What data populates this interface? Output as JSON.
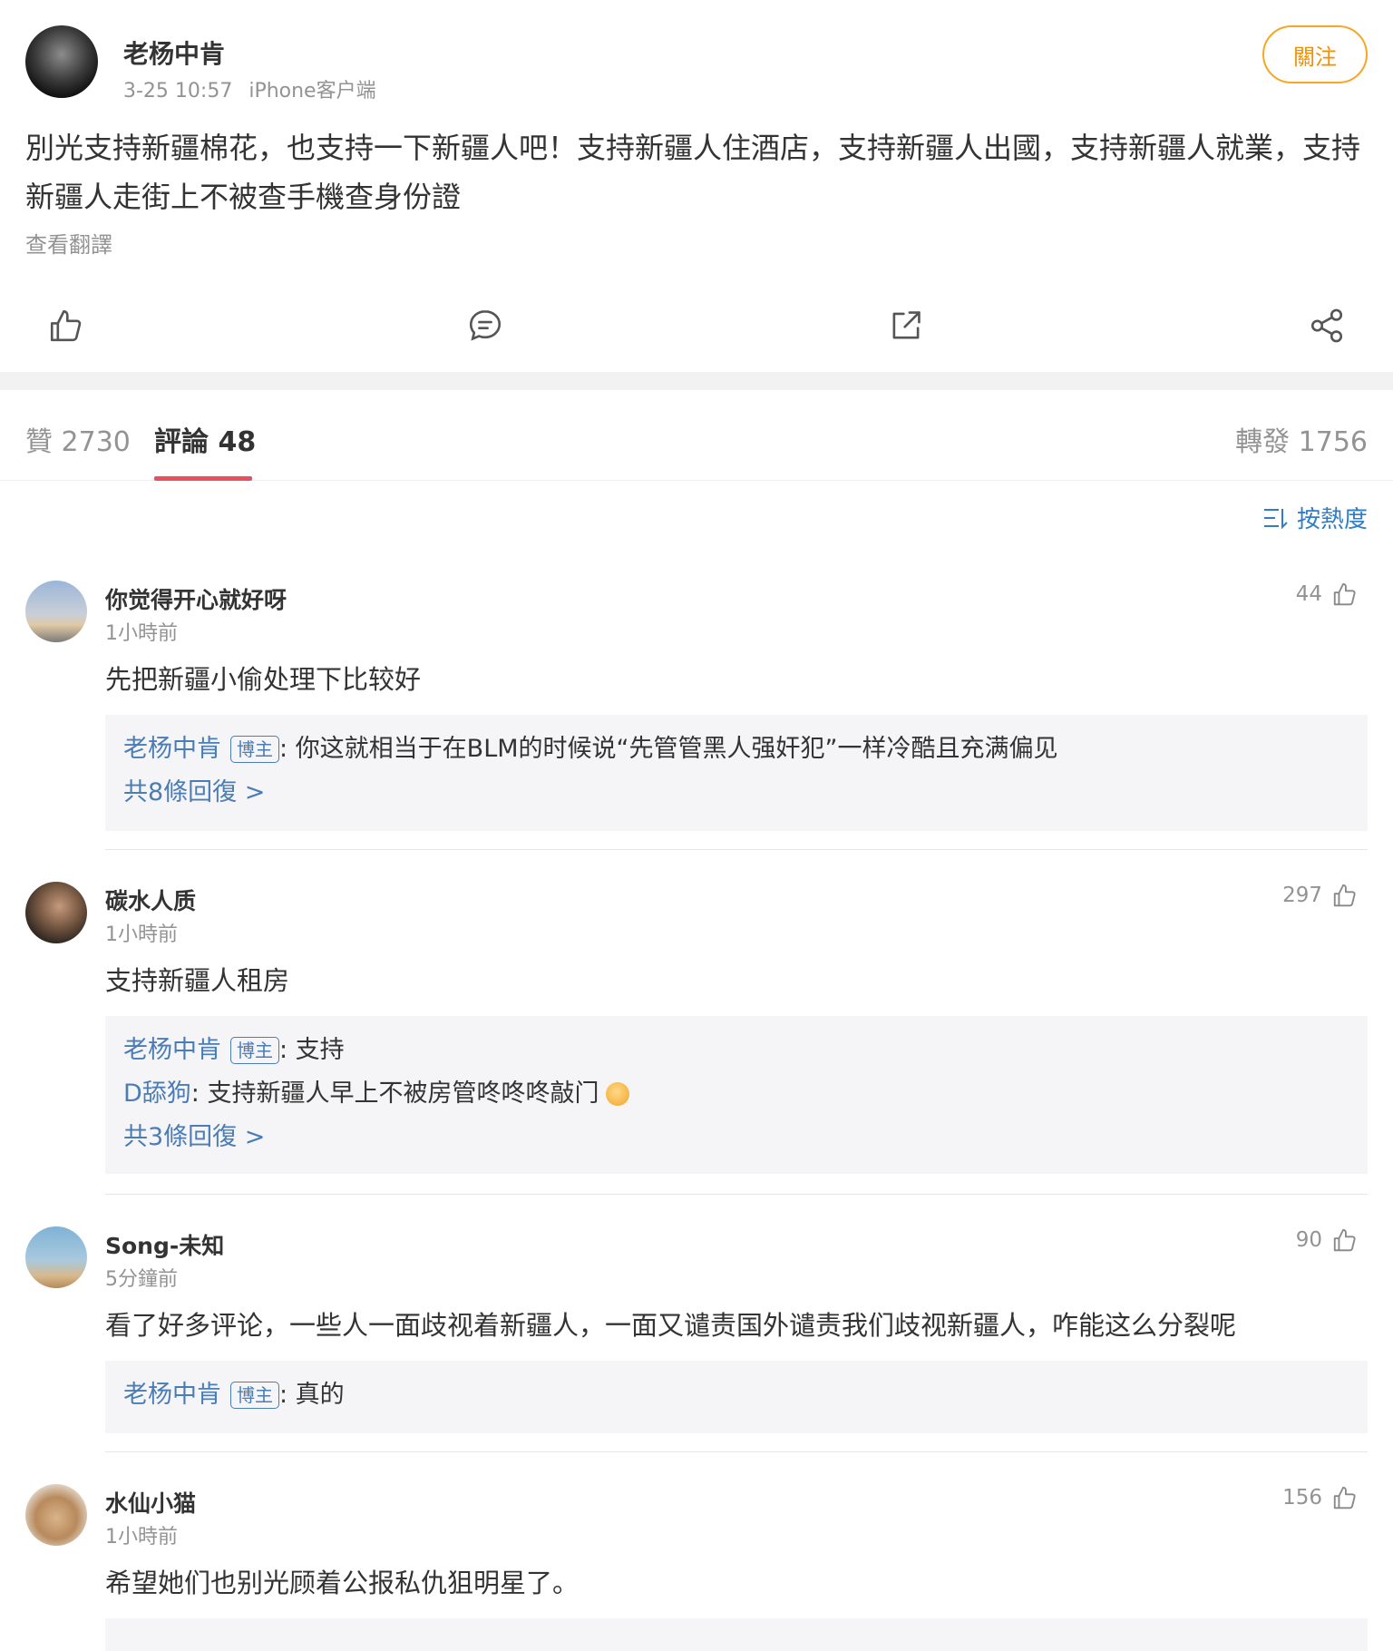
{
  "post": {
    "author": "老杨中肯",
    "time": "3-25 10:57",
    "source": "iPhone客户端",
    "follow_label": "關注",
    "text": "別光支持新疆棉花，也支持一下新疆人吧！支持新疆人住酒店，支持新疆人出國，支持新疆人就業，支持新疆人走街上不被查手機查身份證",
    "translate_label": "查看翻譯"
  },
  "actions": [
    "like-icon",
    "comment-icon",
    "repost-icon",
    "share-icon"
  ],
  "tabs": {
    "likes": "贊 2730",
    "comments": "評論 48",
    "reposts": "轉發 1756"
  },
  "sort": {
    "label": "按熱度",
    "icon": "sort-icon"
  },
  "comments": [
    {
      "name": "你觉得开心就好呀",
      "time": "1小時前",
      "likes": "44",
      "text": "先把新疆小偷处理下比较好",
      "replies": [
        {
          "name": "老杨中肯",
          "badge": "博主",
          "text": ": 你这就相当于在BLM的时候说“先管管黑人强奸犯”一样冷酷且充满偏见"
        }
      ],
      "more": "共8條回復 >"
    },
    {
      "name": "碳水人质",
      "time": "1小時前",
      "likes": "297",
      "text": "支持新疆人租房",
      "replies": [
        {
          "name": "老杨中肯",
          "badge": "博主",
          "text": ": 支持"
        },
        {
          "name": "D舔狗",
          "badge": "",
          "text": ": 支持新疆人早上不被房管咚咚咚敲门"
        }
      ],
      "more": "共3條回復 >"
    },
    {
      "name": "Song-未知",
      "time": "5分鐘前",
      "likes": "90",
      "text": "看了好多评论，一些人一面歧视着新疆人，一面又谴责国外谴责我们歧视新疆人，咋能这么分裂呢",
      "replies": [
        {
          "name": "老杨中肯",
          "badge": "博主",
          "text": ": 真的"
        }
      ],
      "more": ""
    },
    {
      "name": "水仙小猫",
      "time": "1小時前",
      "likes": "156",
      "text": "希望她们也别光顾着公报私仇狙明星了。",
      "replies": [],
      "more": ""
    }
  ]
}
